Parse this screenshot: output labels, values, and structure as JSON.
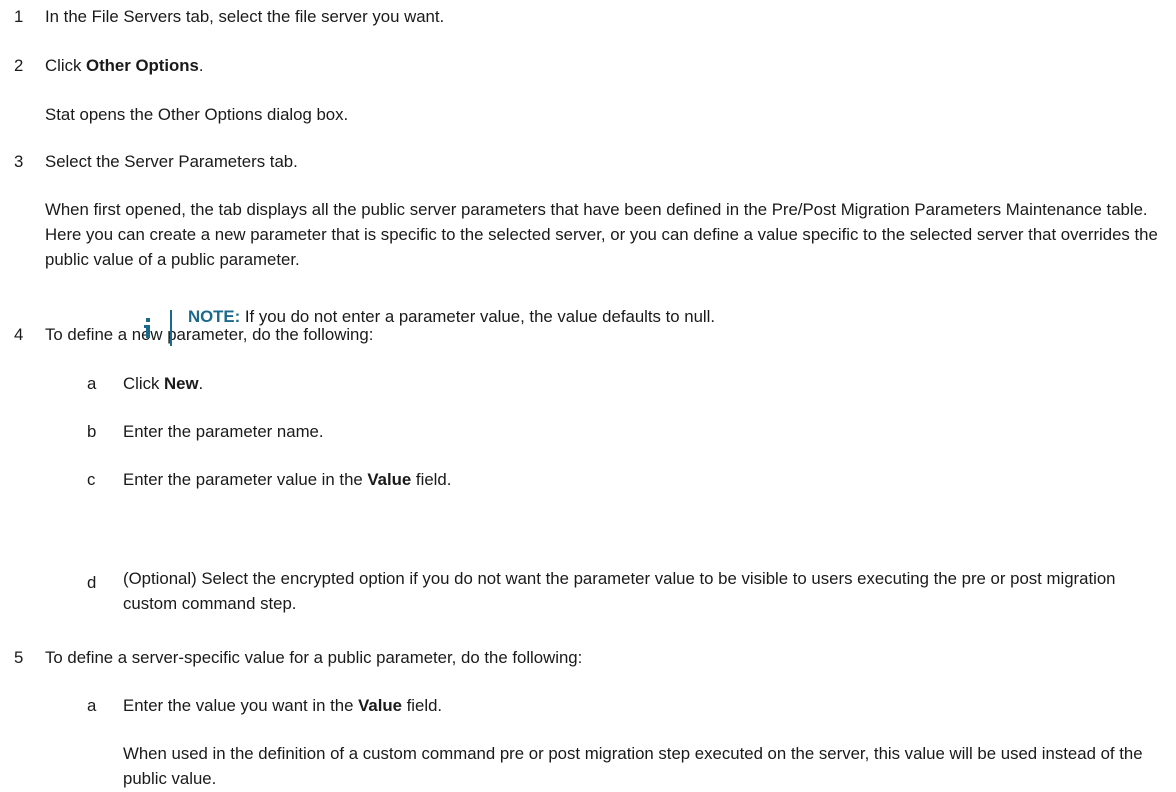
{
  "steps": [
    {
      "num": "1",
      "text": "In the File Servers tab, select the file server you want."
    },
    {
      "num": "2",
      "pre": "Click ",
      "bold": "Other Options",
      "post": "."
    },
    {
      "result": "Stat opens the Other Options dialog box."
    },
    {
      "num": "3",
      "text": "Select the Server Parameters tab."
    },
    {
      "para": "When first opened, the tab displays all the public server parameters that have been defined in the Pre/Post Migration Parameters Maintenance table. Here you can create a new parameter that is specific to the selected server, or you can define a value specific to the selected server that overrides the public value of a public parameter."
    },
    {
      "num": "4",
      "text": "To define a new parameter, do the following:"
    },
    {
      "num": "5",
      "text": "To define a server-specific value for a public parameter, do the following:"
    }
  ],
  "step4_subs": [
    {
      "letter": "a",
      "pre": "Click ",
      "bold": "New",
      "post": "."
    },
    {
      "letter": "b",
      "text": "Enter the parameter name."
    },
    {
      "letter": "c",
      "pre": "Enter the parameter value in the ",
      "bold": "Value",
      "post": " field."
    },
    {
      "letter": "d",
      "text": "(Optional) Select the encrypted option if you do not want the parameter value to be visible to users executing the pre or post migration custom command step."
    }
  ],
  "note": {
    "label": "NOTE:",
    "text": " If you do not enter a parameter value, the value defaults to null.",
    "icon": "info-icon",
    "color": "#1a6a8c"
  },
  "step5_subs": [
    {
      "letter": "a",
      "pre": "Enter the value you want in the ",
      "bold": "Value",
      "post": " field."
    }
  ],
  "step5_para": "When used in the definition of a custom command pre or post migration step executed on the server, this value will be used instead of the public value."
}
